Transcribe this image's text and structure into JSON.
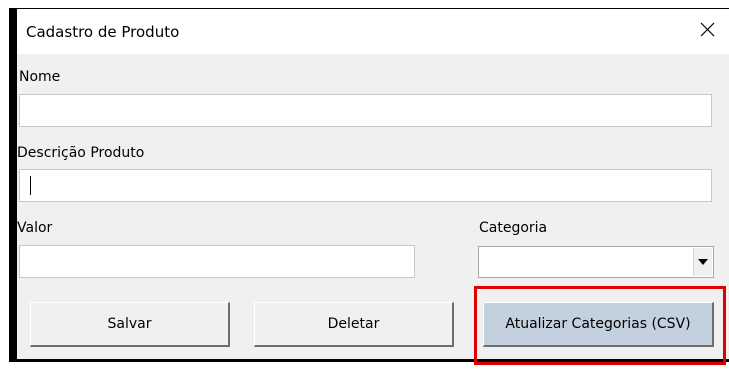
{
  "window": {
    "title": "Cadastro de Produto",
    "close_glyph": "✕"
  },
  "form": {
    "nome": {
      "label": "Nome",
      "value": ""
    },
    "descricao": {
      "label": "Descrição Produto",
      "value": ""
    },
    "valor": {
      "label": "Valor",
      "value": ""
    },
    "categoria": {
      "label": "Categoria",
      "selected": ""
    }
  },
  "buttons": {
    "salvar": "Salvar",
    "deletar": "Deletar",
    "atualizar": "Atualizar Categorias (CSV)"
  },
  "colors": {
    "highlight": "#e00000",
    "primary_button": "#c3d1df",
    "dialog_bg": "#f0f0f0"
  }
}
